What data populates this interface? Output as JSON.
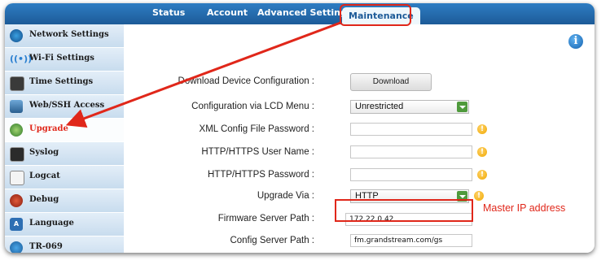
{
  "tabs": [
    {
      "label": "Status"
    },
    {
      "label": "Account"
    },
    {
      "label": "Advanced Settings"
    },
    {
      "label": "Maintenance"
    }
  ],
  "sidebar": {
    "items": [
      {
        "label": "Network Settings",
        "icon": "network-icon"
      },
      {
        "label": "Wi-Fi Settings",
        "icon": "wifi-icon"
      },
      {
        "label": "Time Settings",
        "icon": "clock-icon"
      },
      {
        "label": "Web/SSH Access",
        "icon": "web-access-icon"
      },
      {
        "label": "Upgrade",
        "icon": "upgrade-icon",
        "active": true
      },
      {
        "label": "Syslog",
        "icon": "syslog-icon"
      },
      {
        "label": "Logcat",
        "icon": "logcat-icon"
      },
      {
        "label": "Debug",
        "icon": "debug-icon"
      },
      {
        "label": "Language",
        "icon": "language-icon"
      },
      {
        "label": "TR-069",
        "icon": "tr069-icon"
      }
    ]
  },
  "form": {
    "download_label": "Download Device Configuration :",
    "download_button": "Download",
    "lcd_label": "Configuration via LCD Menu :",
    "lcd_value": "Unrestricted",
    "xml_label": "XML Config File Password :",
    "xml_value": "",
    "http_user_label": "HTTP/HTTPS User Name :",
    "http_user_value": "",
    "http_pass_label": "HTTP/HTTPS Password :",
    "http_pass_value": "",
    "upgrade_via_label": "Upgrade Via :",
    "upgrade_via_value": "HTTP",
    "firmware_label": "Firmware Server Path :",
    "firmware_value": "172.22.0.42",
    "config_label": "Config Server Path :",
    "config_value": "fm.grandstream.com/gs"
  },
  "annotation": {
    "text": "Master IP address"
  },
  "colors": {
    "accent": "#e0271a",
    "topbar": "#1d5b98",
    "sidebar": "#d6e8f5"
  }
}
